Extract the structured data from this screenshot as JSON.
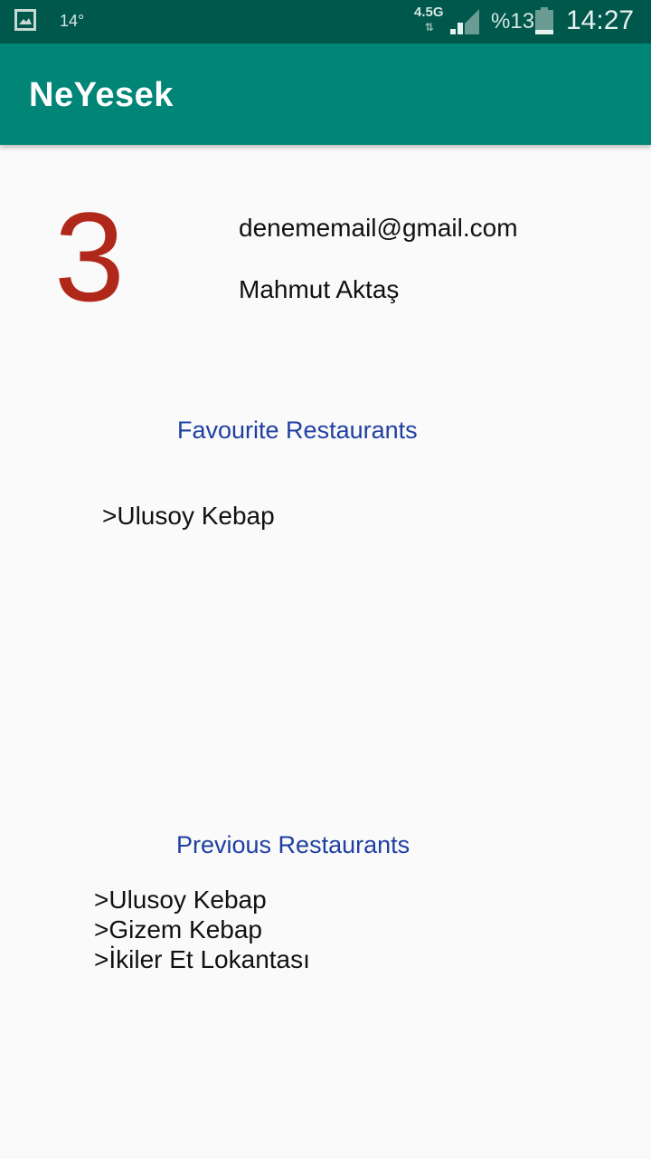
{
  "status_bar": {
    "temperature": "14°",
    "network_type": "4.5G",
    "network_arrows": "⇅",
    "battery_percent": "%13",
    "time": "14:27",
    "icons": [
      "gallery-icon",
      "signal-icon",
      "battery-icon"
    ]
  },
  "app_bar": {
    "title": "NeYesek",
    "color": "#008577"
  },
  "profile": {
    "counter": "3",
    "counter_color": "#b0281a",
    "email": "denememail@gmail.com",
    "name": "Mahmut Aktaş"
  },
  "favourites": {
    "title": "Favourite Restaurants",
    "items": [
      ">Ulusoy Kebap"
    ]
  },
  "previous": {
    "title": "Previous Restaurants",
    "items": [
      ">Ulusoy Kebap",
      ">Gizem Kebap",
      ">İkiler Et Lokantası"
    ]
  },
  "colors": {
    "status_bar": "#00574b",
    "section_title": "#1f3fa3",
    "background": "#fafafa"
  }
}
